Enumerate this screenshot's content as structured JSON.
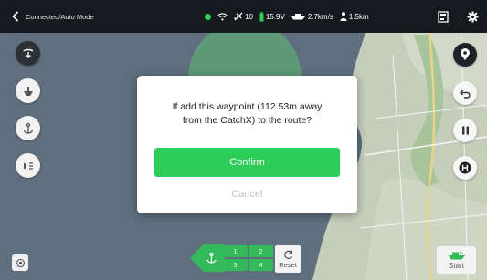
{
  "topbar": {
    "mode": "Connected/Auto Mode",
    "satellites": "10",
    "voltage": "15.9V",
    "speed": "2.7km/s",
    "distance": "1.5km",
    "status_color": "#2fcf55"
  },
  "dialog": {
    "message_line1": "If add this waypoint (112.53m away",
    "message_line2": "from the CatchX) to the route?",
    "confirm_label": "Confirm",
    "cancel_label": "Cancel"
  },
  "bottom": {
    "waypoints": [
      "1",
      "2",
      "3",
      "4"
    ],
    "reset_label": "Reset",
    "start_label": "Start"
  },
  "colors": {
    "accent": "#2ecc59",
    "water": "#5f6f7e",
    "land": "#bdc7b3",
    "topbar": "#151a1e"
  }
}
